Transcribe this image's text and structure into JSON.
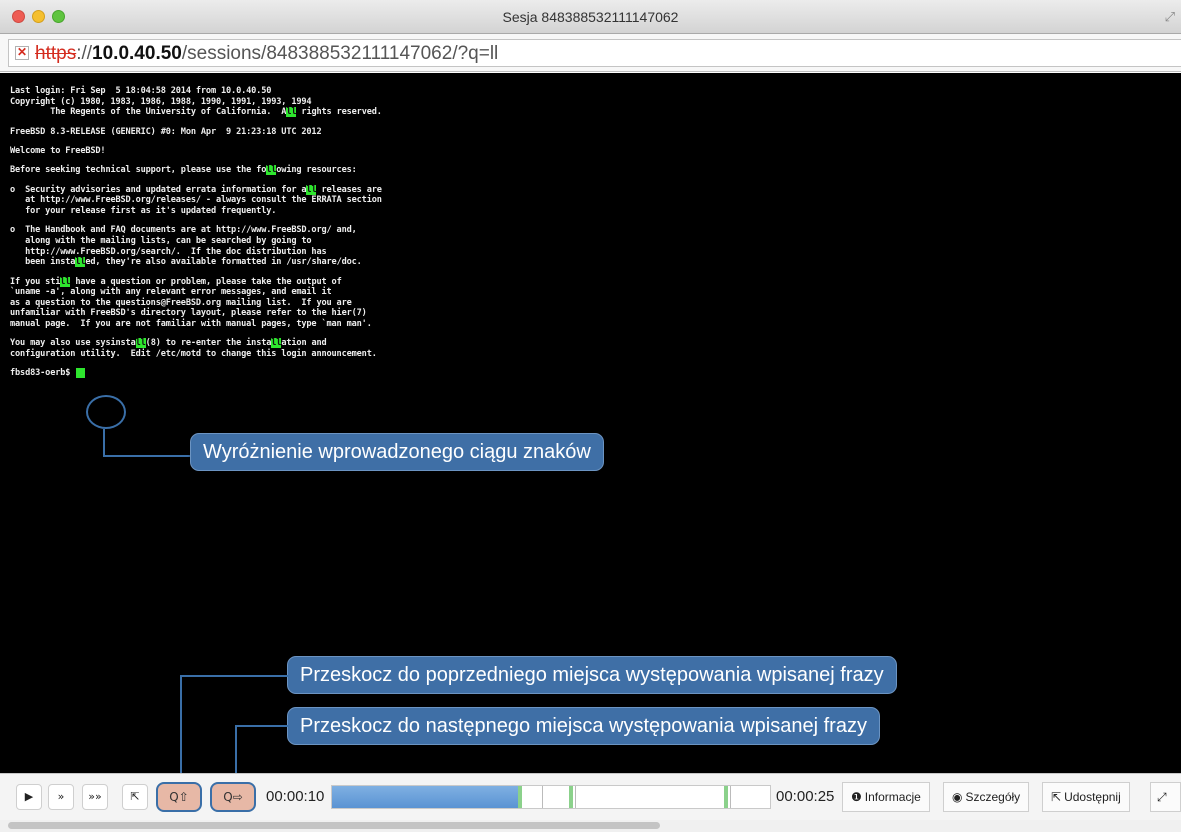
{
  "window": {
    "title": "Sesja 848388532111147062"
  },
  "address_bar": {
    "scheme": "https",
    "rest_prefix": "://",
    "host": "10.0.40.50",
    "path": "/sessions/848388532111147062/?q=ll"
  },
  "terminal": {
    "lines": [
      "Last login: Fri Sep  5 18:04:58 2014 from 10.0.40.50",
      "Copyright (c) 1980, 1983, 1986, 1988, 1990, 1991, 1993, 1994",
      "        The Regents of the University of California.  All rights reserved.",
      "",
      "FreeBSD 8.3-RELEASE (GENERIC) #0: Mon Apr  9 21:23:18 UTC 2012",
      "",
      "Welcome to FreeBSD!",
      "",
      "Before seeking technical support, please use the following resources:",
      "",
      "o  Security advisories and updated errata information for all releases are",
      "   at http://www.FreeBSD.org/releases/ - always consult the ERRATA section",
      "   for your release first as it's updated frequently.",
      "",
      "o  The Handbook and FAQ documents are at http://www.FreeBSD.org/ and,",
      "   along with the mailing lists, can be searched by going to",
      "   http://www.FreeBSD.org/search/.  If the doc distribution has",
      "   been installed, they're also available formatted in /usr/share/doc.",
      "",
      "If you still have a question or problem, please take the output of",
      "`uname -a', along with any relevant error messages, and email it",
      "as a question to the questions@FreeBSD.org mailing list.  If you are",
      "unfamiliar with FreeBSD's directory layout, please refer to the hier(7)",
      "manual page.  If you are not familiar with manual pages, type `man man'.",
      "",
      "You may also use sysinstall(8) to re-enter the installation and",
      "configuration utility.  Edit /etc/motd to change this login announcement.",
      ""
    ],
    "prompt": "fbsd83-oerb$",
    "search_term": "ll"
  },
  "callouts": {
    "highlight": "Wyróżnienie wprowadzonego ciągu znaków",
    "prev": "Przeskocz do poprzedniego miejsca występowania wpisanej frazy",
    "next": "Przeskocz do następnego miejsca występowania wpisanej frazy"
  },
  "player": {
    "current_time": "00:00:10",
    "total_time": "00:00:25",
    "progress": 0.43,
    "match_marks": [
      0.425,
      0.54,
      0.895
    ],
    "ticks": [
      0.465,
      0.54,
      0.895
    ],
    "buttons": {
      "play": "▶",
      "fast": "»",
      "faster": "»»",
      "share_small": "⇱",
      "prev_search": "Q⇧",
      "next_search": "Q⇨"
    },
    "tabs": {
      "info": "Informacje",
      "details": "Szczegóły",
      "share": "Udostępnij"
    },
    "icons": {
      "info": "❶",
      "details": "◉",
      "share": "⇱",
      "expand": "⤢"
    }
  }
}
